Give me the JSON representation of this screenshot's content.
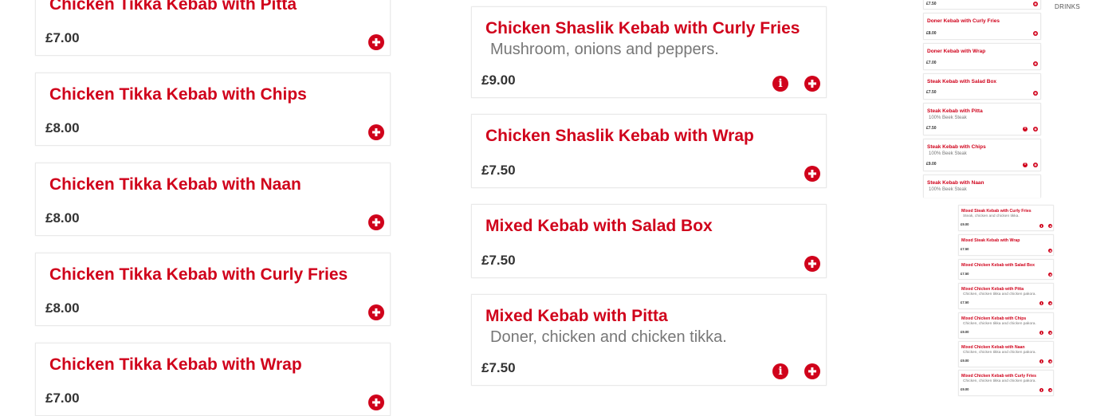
{
  "colors": {
    "accent": "#d0021b",
    "price": "#333333",
    "description": "#777777"
  },
  "icons": {
    "add": "plus-circle-icon",
    "info": "info-icon"
  },
  "nav": {
    "drinks": "DRINKS"
  },
  "column_a": [
    {
      "name": "Chicken Tikka Kebab with Pitta",
      "price": "£7.00"
    },
    {
      "name": "Chicken Tikka Kebab with Chips",
      "price": "£8.00"
    },
    {
      "name": "Chicken Tikka Kebab with Naan",
      "price": "£8.00"
    },
    {
      "name": "Chicken Tikka Kebab with Curly Fries",
      "price": "£8.00"
    },
    {
      "name": "Chicken Tikka Kebab with Wrap",
      "price": "£7.00"
    }
  ],
  "column_b": [
    {
      "name": "Chicken Shaslik Kebab with Curly Fries",
      "description": "Mushroom, onions and peppers.",
      "price": "£9.00"
    },
    {
      "name": "Chicken Shaslik Kebab with Wrap",
      "price": "£7.50"
    },
    {
      "name": "Mixed Kebab with Salad Box",
      "price": "£7.50"
    },
    {
      "name": "Mixed Kebab with Pitta",
      "description": "Doner, chicken and chicken tikka.",
      "price": "£7.50"
    }
  ],
  "column_c": {
    "top_price": "£7.50",
    "items": [
      {
        "name": "Doner Kebab with Curly Fries",
        "price": "£8.00"
      },
      {
        "name": "Doner Kebab with Wrap",
        "price": "£7.00"
      },
      {
        "name": "Steak Kebab with Salad Box",
        "price": "£7.50"
      },
      {
        "name": "Steak Kebab with Pitta",
        "description": "100% Beek Steak",
        "price": "£7.50"
      },
      {
        "name": "Steak Kebab with Chips",
        "description": "100% Beek Steak",
        "price": "£9.00"
      },
      {
        "name": "Steak Kebab with Naan",
        "description": "100% Beek Steak",
        "price": ""
      }
    ]
  },
  "column_d": [
    {
      "name": "Mixed Steak Kebab with Curly Fries",
      "description": "Steak, chicken and chicken tikka.",
      "price": "£9.00"
    },
    {
      "name": "Mixed Steak Kebab with Wrap",
      "price": "£7.50"
    },
    {
      "name": "Mixed Chicken Kebab with Salad Box",
      "price": "£7.50"
    },
    {
      "name": "Mixed Chicken Kebab with Pitta",
      "description": "Chicken, chicken tikka and chicken pakora.",
      "price": "£7.50"
    },
    {
      "name": "Mixed Chicken Kebab with Chips",
      "description": "Chicken, chicken tikka and chicken pakora.",
      "price": "£9.00"
    },
    {
      "name": "Mixed Chicken Kebab with Naan",
      "description": "Chicken, chicken tikka and chicken pakora.",
      "price": "£9.00"
    },
    {
      "name": "Mixed Chicken Kebab with Curly Fries",
      "description": "Chicken, chicken tikka and chicken pakora.",
      "price": "£9.00"
    }
  ]
}
